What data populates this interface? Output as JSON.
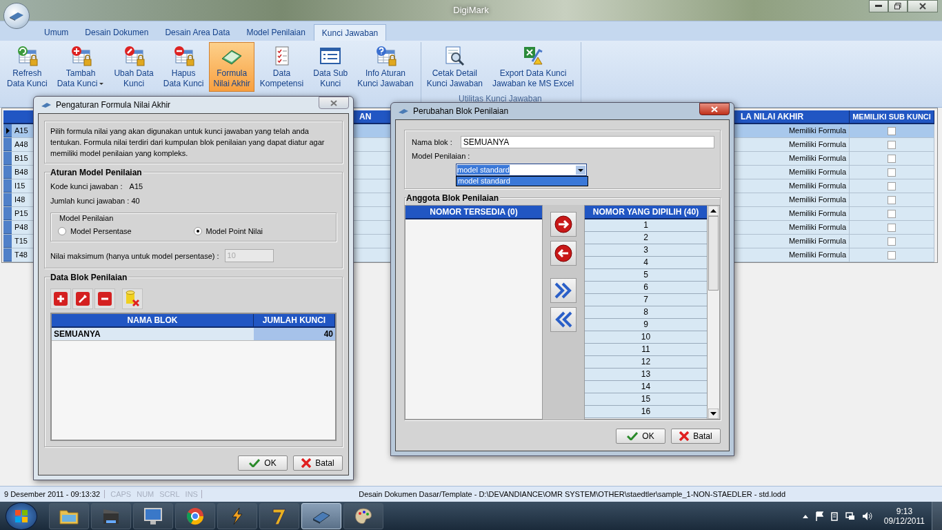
{
  "window": {
    "title": "DigiMark"
  },
  "ribbon_tabs": [
    {
      "label": "Umum",
      "selected": false
    },
    {
      "label": "Desain Dokumen",
      "selected": false
    },
    {
      "label": "Desain Area Data",
      "selected": false
    },
    {
      "label": "Model Penilaian",
      "selected": false
    },
    {
      "label": "Kunci Jawaban",
      "selected": true
    }
  ],
  "ribbon_groups": [
    {
      "items": [
        {
          "kind": "refresh",
          "lines": [
            "Refresh",
            "Data Kunci"
          ],
          "selected": false,
          "dropdown": false
        },
        {
          "kind": "add",
          "lines": [
            "Tambah",
            "Data Kunci"
          ],
          "selected": false,
          "dropdown": true
        },
        {
          "kind": "edit",
          "lines": [
            "Ubah Data",
            "Kunci"
          ],
          "selected": false,
          "dropdown": false
        },
        {
          "kind": "delete",
          "lines": [
            "Hapus",
            "Data Kunci"
          ],
          "selected": false,
          "dropdown": false
        },
        {
          "kind": "formula",
          "lines": [
            "Formula",
            "Nilai Akhir"
          ],
          "selected": true,
          "dropdown": false
        },
        {
          "kind": "competence",
          "lines": [
            "Data",
            "Kompetensi"
          ],
          "selected": false,
          "dropdown": false
        },
        {
          "kind": "sub",
          "lines": [
            "Data Sub",
            "Kunci"
          ],
          "selected": false,
          "dropdown": false
        },
        {
          "kind": "info",
          "lines": [
            "Info Aturan",
            "Kunci Jawaban"
          ],
          "selected": false,
          "dropdown": false
        }
      ]
    },
    {
      "label": "Utilitas Kunci Jawaban",
      "items": [
        {
          "kind": "print",
          "lines": [
            "Cetak Detail",
            "Kunci Jawaban"
          ],
          "selected": false,
          "dropdown": false
        },
        {
          "kind": "export",
          "lines": [
            "Export Data Kunci",
            "Jawaban ke MS Excel"
          ],
          "selected": false,
          "dropdown": false
        }
      ]
    }
  ],
  "background_table": {
    "headers": [
      "AN",
      "LA NILAI AKHIR",
      "MEMILIKI SUB KUNCI"
    ],
    "rows": [
      {
        "code": "A15",
        "column_3": "Memiliki Formula",
        "sub_key": false,
        "selected": true
      },
      {
        "code": "A48",
        "column_3": "Memiliki Formula",
        "sub_key": false,
        "selected": false
      },
      {
        "code": "B15",
        "column_3": "Memiliki Formula",
        "sub_key": false,
        "selected": false
      },
      {
        "code": "B48",
        "column_3": "Memiliki Formula",
        "sub_key": false,
        "selected": false
      },
      {
        "code": "I15",
        "column_3": "Memiliki Formula",
        "sub_key": false,
        "selected": false
      },
      {
        "code": "I48",
        "column_3": "Memiliki Formula",
        "sub_key": false,
        "selected": false
      },
      {
        "code": "P15",
        "column_3": "Memiliki Formula",
        "sub_key": false,
        "selected": false
      },
      {
        "code": "P48",
        "column_3": "Memiliki Formula",
        "sub_key": false,
        "selected": false
      },
      {
        "code": "T15",
        "column_3": "Memiliki Formula",
        "sub_key": false,
        "selected": false
      },
      {
        "code": "T48",
        "column_3": "Memiliki Formula",
        "sub_key": false,
        "selected": false
      }
    ]
  },
  "formula_dialog": {
    "title": "Pengaturan Formula Nilai Akhir",
    "description": "Pilih formula nilai yang akan digunakan untuk kunci jawaban yang telah anda tentukan. Formula nilai terdiri dari kumpulan blok penilaian yang dapat diatur agar memiliki model penilaian yang kompleks.",
    "rules": {
      "title": "Aturan Model Penilaian",
      "code_label": "Kode kunci jawaban :",
      "code": "A15",
      "count_text": "Jumlah kunci jawaban : 40",
      "model": {
        "title": "Model Penilaian",
        "options": [
          {
            "label": "Model Persentase",
            "selected": false
          },
          {
            "label": "Model Point Nilai",
            "selected": true
          }
        ]
      },
      "max_label": "Nilai maksimum (hanya untuk model persentase) :",
      "max_value": "10",
      "max_disabled": true
    },
    "blocks": {
      "title": "Data Blok Penilaian",
      "tools": [
        {
          "kind": "add"
        },
        {
          "kind": "edit"
        },
        {
          "kind": "remove"
        },
        {
          "kind": "database-delete"
        }
      ],
      "columns": [
        "NAMA BLOK",
        "JUMLAH KUNCI"
      ],
      "rows": [
        {
          "name": "SEMUANYA",
          "count": "40"
        }
      ]
    },
    "buttons": [
      {
        "kind": "ok",
        "label": "OK"
      },
      {
        "kind": "cancel",
        "label": "Batal"
      }
    ]
  },
  "block_dialog": {
    "title": "Perubahan Blok Penilaian",
    "name_label": "Nama blok :",
    "name_value": "SEMUANYA",
    "model_label": "Model Penilaian :",
    "model_value": "model standard",
    "model_options": [
      {
        "label": "model standard",
        "selected": true
      }
    ],
    "members": {
      "title": "Anggota Blok Penilaian",
      "available": {
        "header": "NOMOR TERSEDIA (0)"
      },
      "transfer": [
        {
          "kind": "right"
        },
        {
          "kind": "left"
        },
        {
          "kind": "all-right"
        },
        {
          "kind": "all-left"
        }
      ],
      "chosen": {
        "header": "NOMOR YANG DIPILIH (40)",
        "items": [
          "1",
          "2",
          "3",
          "4",
          "5",
          "6",
          "7",
          "8",
          "9",
          "10",
          "11",
          "12",
          "13",
          "14",
          "15",
          "16"
        ]
      }
    },
    "buttons": [
      {
        "kind": "ok",
        "label": "OK"
      },
      {
        "kind": "cancel",
        "label": "Batal"
      }
    ]
  },
  "status_bar": {
    "datetime": "9 Desember 2011 - 09:13:32",
    "keys": [
      {
        "label": "CAPS",
        "on": false
      },
      {
        "label": "NUM",
        "on": false
      },
      {
        "label": "SCRL",
        "on": false
      },
      {
        "label": "INS",
        "on": false
      }
    ],
    "path": "Desain Dokumen Dasar/Template - D:\\DEVANDIANCE\\OMR SYSTEM\\OTHER\\staedtler\\sample_1-NON-STAEDLER - std.lodd"
  },
  "taskbar": {
    "apps": [
      {
        "kind": "folder",
        "selected": false
      },
      {
        "kind": "film",
        "selected": false
      },
      {
        "kind": "monitor",
        "selected": false
      },
      {
        "kind": "browser",
        "selected": false
      },
      {
        "kind": "lightning",
        "selected": false
      },
      {
        "kind": "seven",
        "selected": false
      },
      {
        "kind": "scanner",
        "selected": true
      },
      {
        "kind": "palette",
        "selected": false
      }
    ],
    "time": "9:13",
    "date": "09/12/2011"
  }
}
